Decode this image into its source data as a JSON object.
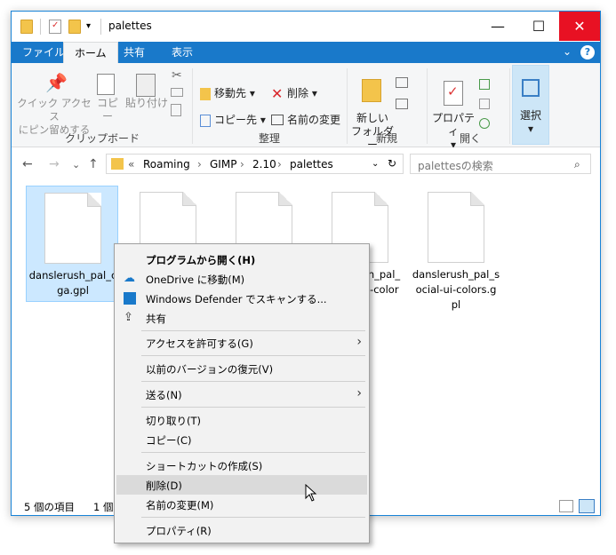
{
  "window": {
    "title": "palettes",
    "controls": {
      "minimize": "—",
      "maximize": "☐",
      "close": "✕"
    }
  },
  "tabs": {
    "file": "ファイル",
    "home": "ホーム",
    "share": "共有",
    "view": "表示",
    "help": "?"
  },
  "ribbon": {
    "clipboard": {
      "pin": "クイック アクセス\nにピン留めする",
      "copy": "コピー",
      "paste": "貼り付け",
      "label": "クリップボード"
    },
    "organize": {
      "move_to": "移動先",
      "copy_to": "コピー先",
      "delete": "削除",
      "rename": "名前の変更",
      "label": "整理"
    },
    "new": {
      "new_folder": "新しい\nフォルダー",
      "label": "新規"
    },
    "open": {
      "properties": "プロパティ",
      "label": "開く"
    },
    "select": {
      "select": "選択"
    }
  },
  "address": {
    "crumbs": [
      "«",
      "Roaming",
      "GIMP",
      "2.10",
      "palettes"
    ],
    "search_placeholder": "palettesの検索"
  },
  "files": [
    {
      "name": "danslerush_pal_cga.gpl",
      "display": "danslerush_pal_c\nga.gpl",
      "selected": true
    },
    {
      "name": "",
      "display": ""
    },
    {
      "name": "",
      "display": ""
    },
    {
      "name": "",
      "display": "rush_pal_\nr-ui-color"
    },
    {
      "name": "danslerush_pal_social-ui-colors.gpl",
      "display": "danslerush_pal_s\nocial-ui-colors.g\npl"
    }
  ],
  "status": {
    "count": "5 個の項目",
    "selected": "1 個の"
  },
  "context_menu": {
    "items": [
      {
        "label": "プログラムから開く(H)",
        "bold": true
      },
      {
        "label": "OneDrive に移動(M)",
        "icon": "cloud-icon"
      },
      {
        "label": "Windows Defender でスキャンする...",
        "icon": "shield-icon"
      },
      {
        "label": "共有",
        "icon": "share-icon"
      },
      {
        "label": "アクセスを許可する(G)",
        "submenu": true
      },
      {
        "label": "以前のバージョンの復元(V)"
      },
      {
        "label": "送る(N)",
        "submenu": true
      },
      {
        "label": "切り取り(T)"
      },
      {
        "label": "コピー(C)"
      },
      {
        "label": "ショートカットの作成(S)"
      },
      {
        "label": "削除(D)",
        "highlighted": true
      },
      {
        "label": "名前の変更(M)"
      },
      {
        "label": "プロパティ(R)"
      }
    ]
  },
  "colors": {
    "accent": "#1979ca",
    "selection": "#cce8ff",
    "close": "#e81123",
    "folder": "#f3c44b"
  }
}
